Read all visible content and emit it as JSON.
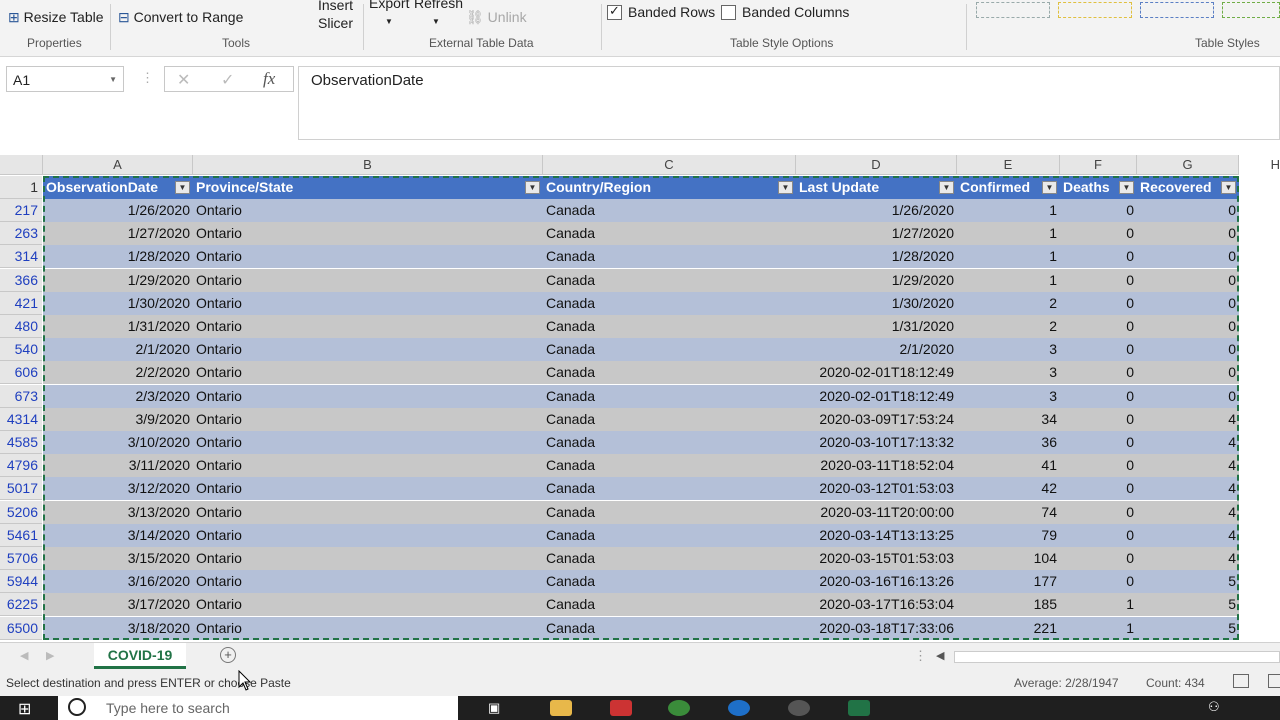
{
  "ribbon": {
    "resize_table": "Resize Table",
    "convert_to_range": "Convert to Range",
    "insert_slicer_1": "Insert",
    "insert_slicer_2": "Slicer",
    "export": "Export",
    "refresh": "Refresh",
    "unlink": "Unlink",
    "banded_rows": "Banded Rows",
    "banded_columns": "Banded Columns",
    "groups": {
      "properties": "Properties",
      "tools": "Tools",
      "external": "External Table Data",
      "style_options": "Table Style Options",
      "table_styles": "Table Styles"
    }
  },
  "formula_bar": {
    "name_box": "A1",
    "fx": "fx",
    "content": "ObservationDate"
  },
  "columns": [
    "A",
    "B",
    "C",
    "D",
    "E",
    "F",
    "G",
    "H"
  ],
  "table_header": [
    "ObservationDate",
    "Province/State",
    "Country/Region",
    "Last Update",
    "Confirmed",
    "Deaths",
    "Recovered"
  ],
  "rows": [
    {
      "n": "217",
      "date": "1/26/2020",
      "prov": "Ontario",
      "country": "Canada",
      "upd": "1/26/2020",
      "conf": "1",
      "deaths": "0",
      "rec": "0"
    },
    {
      "n": "263",
      "date": "1/27/2020",
      "prov": "Ontario",
      "country": "Canada",
      "upd": "1/27/2020",
      "conf": "1",
      "deaths": "0",
      "rec": "0"
    },
    {
      "n": "314",
      "date": "1/28/2020",
      "prov": "Ontario",
      "country": "Canada",
      "upd": "1/28/2020",
      "conf": "1",
      "deaths": "0",
      "rec": "0"
    },
    {
      "n": "366",
      "date": "1/29/2020",
      "prov": "Ontario",
      "country": "Canada",
      "upd": "1/29/2020",
      "conf": "1",
      "deaths": "0",
      "rec": "0"
    },
    {
      "n": "421",
      "date": "1/30/2020",
      "prov": "Ontario",
      "country": "Canada",
      "upd": "1/30/2020",
      "conf": "2",
      "deaths": "0",
      "rec": "0"
    },
    {
      "n": "480",
      "date": "1/31/2020",
      "prov": "Ontario",
      "country": "Canada",
      "upd": "1/31/2020",
      "conf": "2",
      "deaths": "0",
      "rec": "0"
    },
    {
      "n": "540",
      "date": "2/1/2020",
      "prov": "Ontario",
      "country": "Canada",
      "upd": "2/1/2020",
      "conf": "3",
      "deaths": "0",
      "rec": "0"
    },
    {
      "n": "606",
      "date": "2/2/2020",
      "prov": "Ontario",
      "country": "Canada",
      "upd": "2020-02-01T18:12:49",
      "conf": "3",
      "deaths": "0",
      "rec": "0"
    },
    {
      "n": "673",
      "date": "2/3/2020",
      "prov": "Ontario",
      "country": "Canada",
      "upd": "2020-02-01T18:12:49",
      "conf": "3",
      "deaths": "0",
      "rec": "0"
    },
    {
      "n": "4314",
      "date": "3/9/2020",
      "prov": "Ontario",
      "country": "Canada",
      "upd": "2020-03-09T17:53:24",
      "conf": "34",
      "deaths": "0",
      "rec": "4"
    },
    {
      "n": "4585",
      "date": "3/10/2020",
      "prov": "Ontario",
      "country": "Canada",
      "upd": "2020-03-10T17:13:32",
      "conf": "36",
      "deaths": "0",
      "rec": "4"
    },
    {
      "n": "4796",
      "date": "3/11/2020",
      "prov": "Ontario",
      "country": "Canada",
      "upd": "2020-03-11T18:52:04",
      "conf": "41",
      "deaths": "0",
      "rec": "4"
    },
    {
      "n": "5017",
      "date": "3/12/2020",
      "prov": "Ontario",
      "country": "Canada",
      "upd": "2020-03-12T01:53:03",
      "conf": "42",
      "deaths": "0",
      "rec": "4"
    },
    {
      "n": "5206",
      "date": "3/13/2020",
      "prov": "Ontario",
      "country": "Canada",
      "upd": "2020-03-11T20:00:00",
      "conf": "74",
      "deaths": "0",
      "rec": "4"
    },
    {
      "n": "5461",
      "date": "3/14/2020",
      "prov": "Ontario",
      "country": "Canada",
      "upd": "2020-03-14T13:13:25",
      "conf": "79",
      "deaths": "0",
      "rec": "4"
    },
    {
      "n": "5706",
      "date": "3/15/2020",
      "prov": "Ontario",
      "country": "Canada",
      "upd": "2020-03-15T01:53:03",
      "conf": "104",
      "deaths": "0",
      "rec": "4"
    },
    {
      "n": "5944",
      "date": "3/16/2020",
      "prov": "Ontario",
      "country": "Canada",
      "upd": "2020-03-16T16:13:26",
      "conf": "177",
      "deaths": "0",
      "rec": "5"
    },
    {
      "n": "6225",
      "date": "3/17/2020",
      "prov": "Ontario",
      "country": "Canada",
      "upd": "2020-03-17T16:53:04",
      "conf": "185",
      "deaths": "1",
      "rec": "5"
    },
    {
      "n": "6500",
      "date": "3/18/2020",
      "prov": "Ontario",
      "country": "Canada",
      "upd": "2020-03-18T17:33:06",
      "conf": "221",
      "deaths": "1",
      "rec": "5"
    }
  ],
  "sheet_tab": "COVID-19",
  "status": {
    "message": "Select destination and press ENTER or choose Paste",
    "average": "Average: 2/28/1947",
    "count": "Count: 434"
  },
  "taskbar": {
    "search_placeholder": "Type here to search"
  },
  "colors": {
    "header_fill": "#4472c4",
    "band_blue": "#b4c0d8",
    "band_gray": "#c8c8c8",
    "accent_green": "#217346"
  }
}
